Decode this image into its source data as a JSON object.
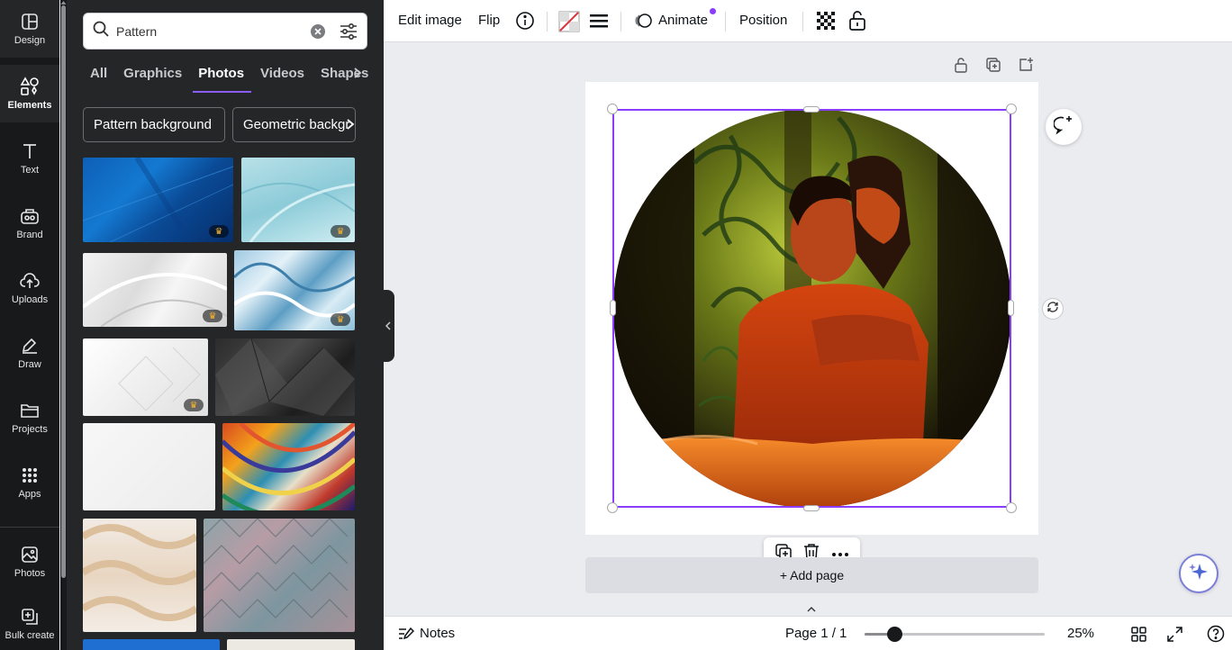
{
  "rail": {
    "items": [
      {
        "label": "Design",
        "icon": "design-icon"
      },
      {
        "label": "Elements",
        "icon": "elements-icon"
      },
      {
        "label": "Text",
        "icon": "text-icon"
      },
      {
        "label": "Brand",
        "icon": "brand-icon"
      },
      {
        "label": "Uploads",
        "icon": "uploads-icon"
      },
      {
        "label": "Draw",
        "icon": "draw-icon"
      },
      {
        "label": "Projects",
        "icon": "projects-icon"
      },
      {
        "label": "Apps",
        "icon": "apps-icon"
      },
      {
        "label": "Photos",
        "icon": "photos-icon"
      },
      {
        "label": "Bulk create",
        "icon": "bulk-create-icon"
      }
    ],
    "active": "Elements"
  },
  "panel": {
    "search_value": "Pattern",
    "tabs": [
      "All",
      "Graphics",
      "Photos",
      "Videos",
      "Shapes"
    ],
    "active_tab": "Photos",
    "chips": [
      "Pattern background",
      "Geometric backgr"
    ]
  },
  "toolbar": {
    "edit_image": "Edit image",
    "flip": "Flip",
    "animate": "Animate",
    "position": "Position",
    "accent": "#8b3dff"
  },
  "canvas": {
    "add_page": "+ Add page"
  },
  "footer": {
    "notes": "Notes",
    "page": "Page 1 / 1",
    "zoom": "25%",
    "zoom_level": 25
  }
}
